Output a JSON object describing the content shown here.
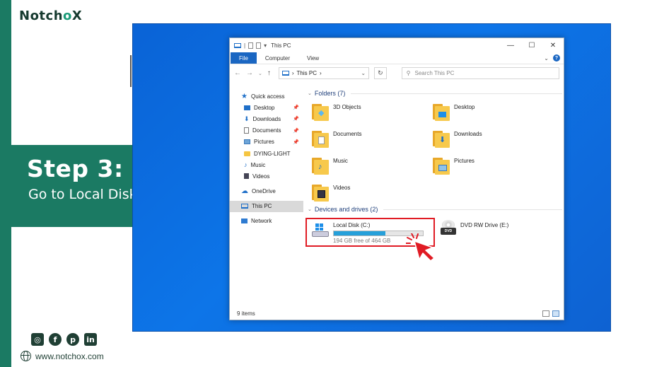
{
  "brand": {
    "logo_part1": "Notch",
    "logo_o": "o",
    "logo_part2": "X",
    "website": "www.notchox.com"
  },
  "step": {
    "title": "Step 3:",
    "description": "Go to Local Disk (C:)"
  },
  "social_icons": [
    "instagram-icon",
    "facebook-icon",
    "pinterest-icon",
    "linkedin-icon"
  ],
  "explorer": {
    "window_title": "This PC",
    "window_controls": {
      "minimize": "—",
      "maximize": "☐",
      "close": "✕"
    },
    "ribbon_tabs": [
      "File",
      "Computer",
      "View"
    ],
    "address": "This PC",
    "search_placeholder": "Search This PC",
    "sidebar": {
      "quick_access": "Quick access",
      "items": [
        {
          "label": "Desktop",
          "pinned": true
        },
        {
          "label": "Downloads",
          "pinned": true
        },
        {
          "label": "Documents",
          "pinned": true
        },
        {
          "label": "Pictures",
          "pinned": true
        },
        {
          "label": "DYING-LIGHT",
          "pinned": false
        },
        {
          "label": "Music",
          "pinned": false
        },
        {
          "label": "Videos",
          "pinned": false
        }
      ],
      "onedrive": "OneDrive",
      "this_pc": "This PC",
      "network": "Network"
    },
    "folders_header": "Folders (7)",
    "folders": [
      "3D Objects",
      "Desktop",
      "Documents",
      "Downloads",
      "Music",
      "Pictures",
      "Videos"
    ],
    "drives_header": "Devices and drives (2)",
    "drive_c": {
      "name": "Local Disk (C:)",
      "free": "194 GB free of 464 GB",
      "used_fraction": 0.58
    },
    "drive_e": {
      "name": "DVD RW Drive (E:)",
      "badge": "DVD"
    },
    "status": "9 items",
    "colors": {
      "accent": "#1a66c2",
      "highlight": "#e01b24",
      "desktop": "#0d75e8",
      "brand_green": "#1b7a63"
    }
  }
}
